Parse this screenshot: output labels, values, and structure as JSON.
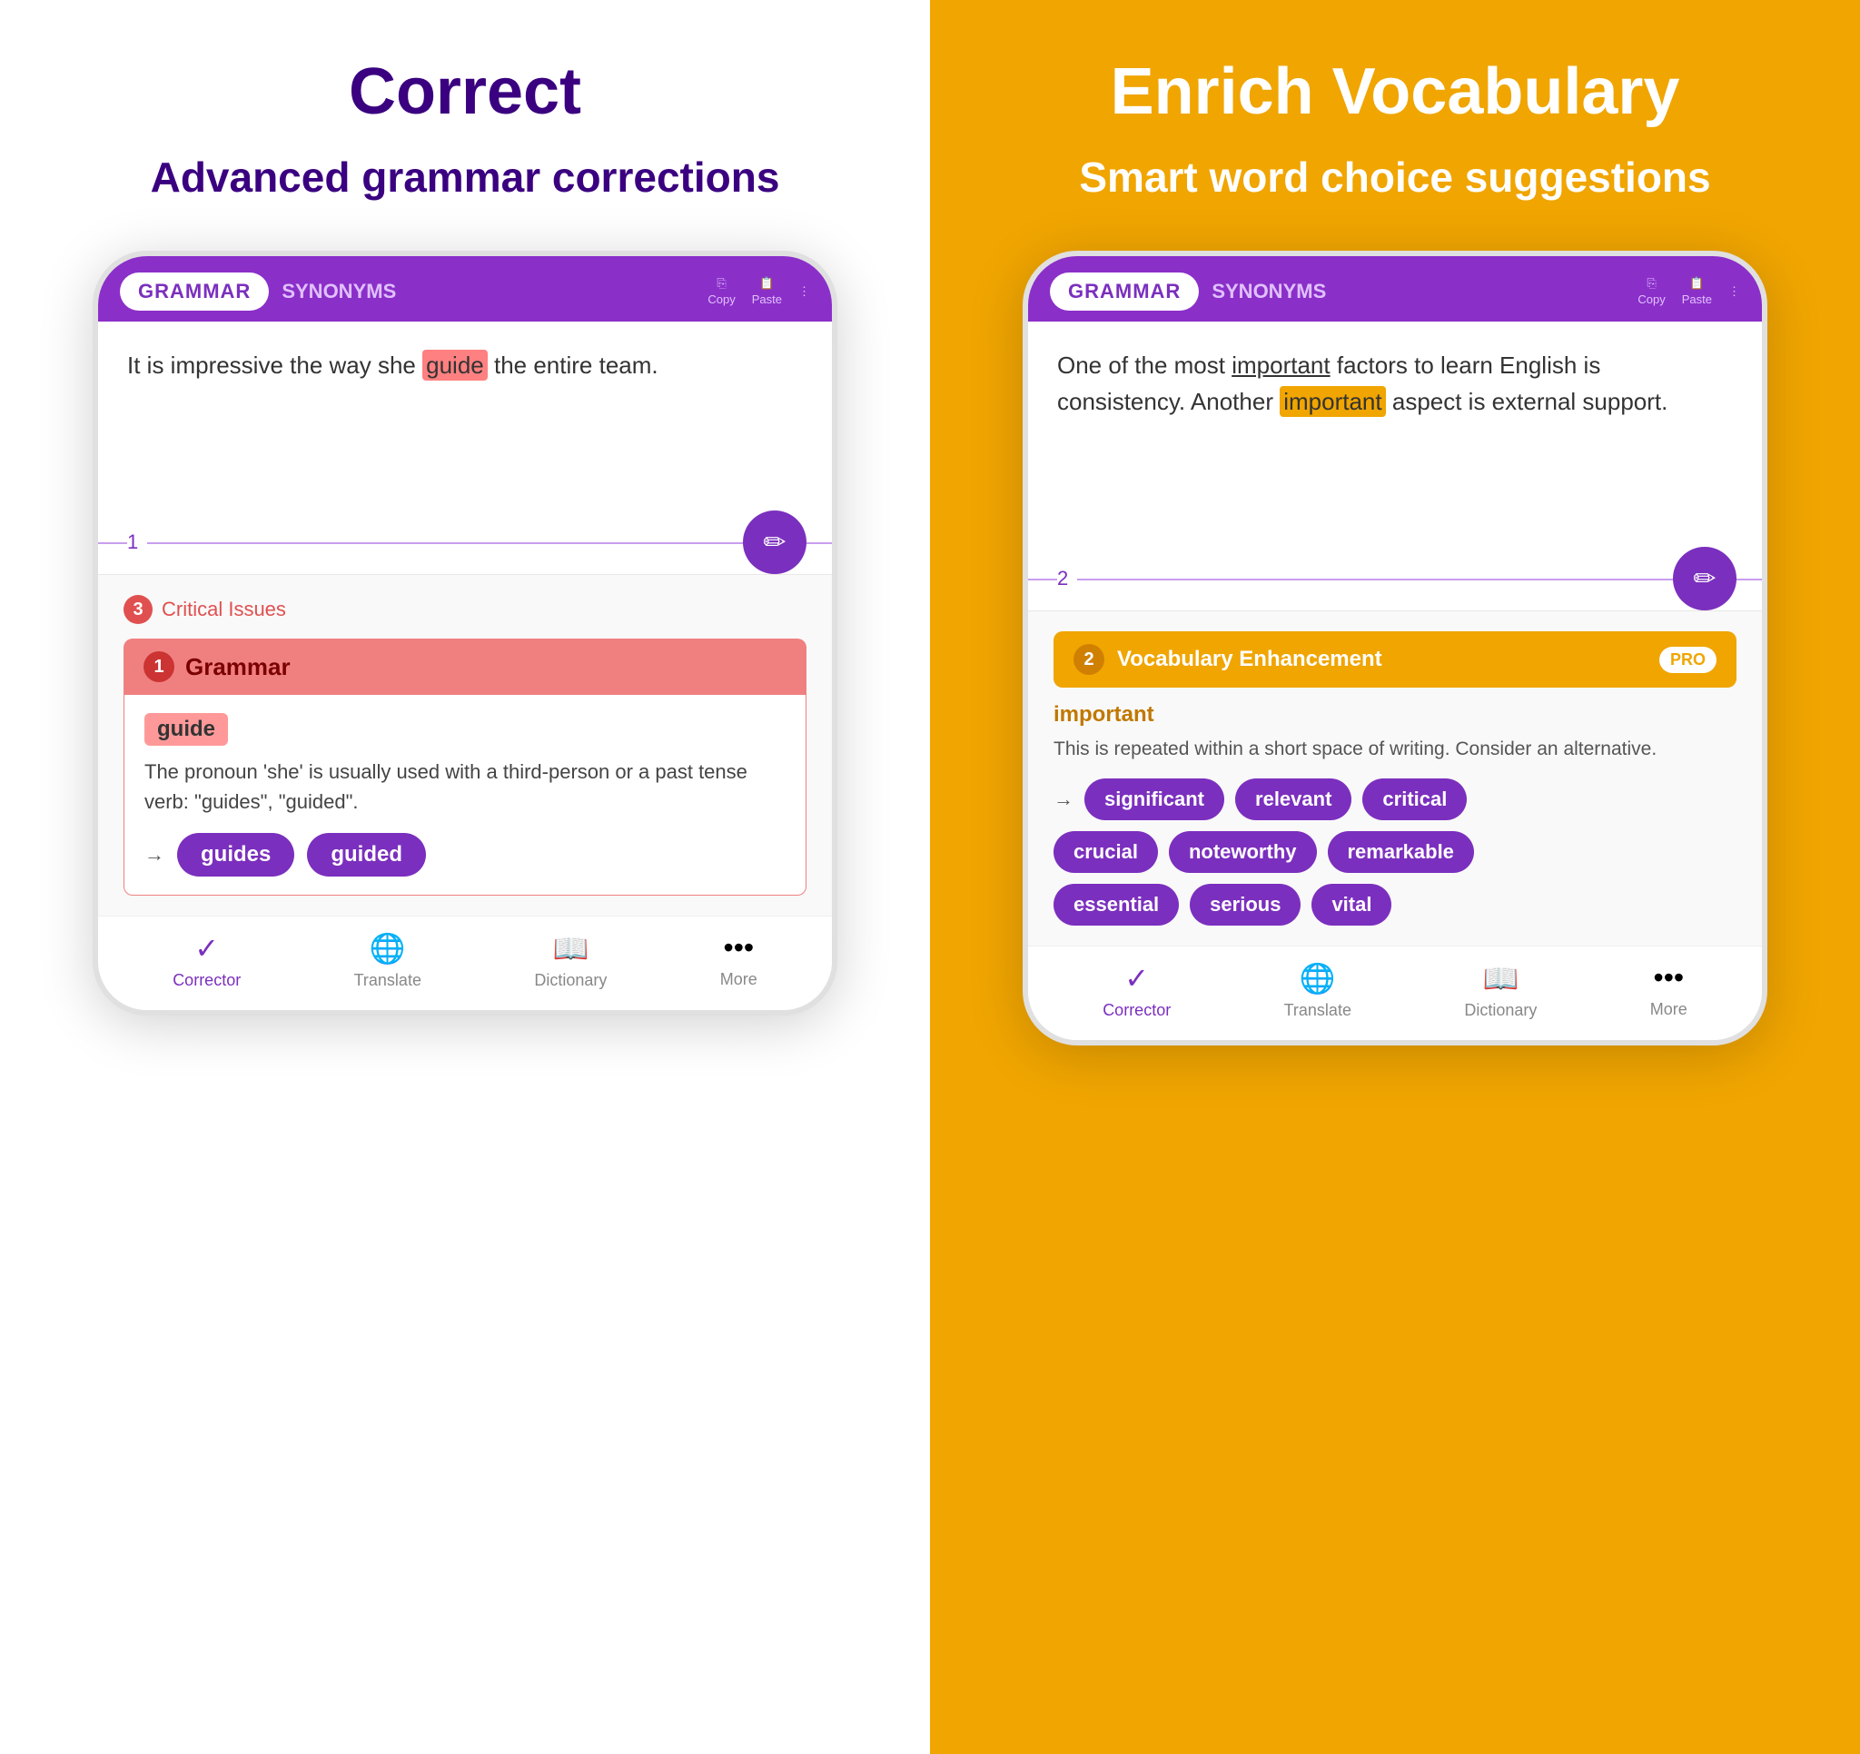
{
  "left_panel": {
    "background": "#ffffff",
    "title": "Correct",
    "subtitle": "Advanced grammar corrections",
    "phone": {
      "tab_grammar": "GRAMMAR",
      "tab_synonyms": "SYNONYMS",
      "icon_copy": "Copy",
      "icon_paste": "Paste",
      "text_content": "It is impressive the way she",
      "highlighted_word": "guide",
      "text_content_after": "the entire team.",
      "divider_num": "1",
      "issues_count": "3",
      "issues_label": "Critical Issues",
      "grammar_section_num": "1",
      "grammar_section_title": "Grammar",
      "error_word": "guide",
      "error_description": "The pronoun 'she' is usually used with a third-person or a past tense verb: \"guides\", \"guided\".",
      "suggestion_1": "guides",
      "suggestion_2": "guided",
      "nav": {
        "corrector_label": "Corrector",
        "translate_label": "Translate",
        "dictionary_label": "Dictionary",
        "more_label": "More"
      }
    }
  },
  "right_panel": {
    "background": "#f0a500",
    "title": "Enrich Vocabulary",
    "subtitle": "Smart word choice suggestions",
    "phone": {
      "tab_grammar": "GRAMMAR",
      "tab_synonyms": "SYNONYMS",
      "icon_copy": "Copy",
      "icon_paste": "Paste",
      "text_content": "One of the most",
      "underline_word": "important",
      "text_content_2": "factors to learn English is consistency. Another",
      "highlight_word": "important",
      "text_content_3": "aspect is external support.",
      "divider_num": "2",
      "vocab_count": "2",
      "vocab_title": "Vocabulary Enhancement",
      "pro_label": "PRO",
      "vocab_word": "important",
      "vocab_desc": "This is repeated within a short space of writing. Consider an alternative.",
      "suggestions": [
        "significant",
        "relevant",
        "critical",
        "crucial",
        "noteworthy",
        "remarkable",
        "essential",
        "serious",
        "vital"
      ],
      "nav": {
        "corrector_label": "Corrector",
        "translate_label": "Translate",
        "dictionary_label": "Dictionary",
        "more_label": "More"
      }
    }
  }
}
